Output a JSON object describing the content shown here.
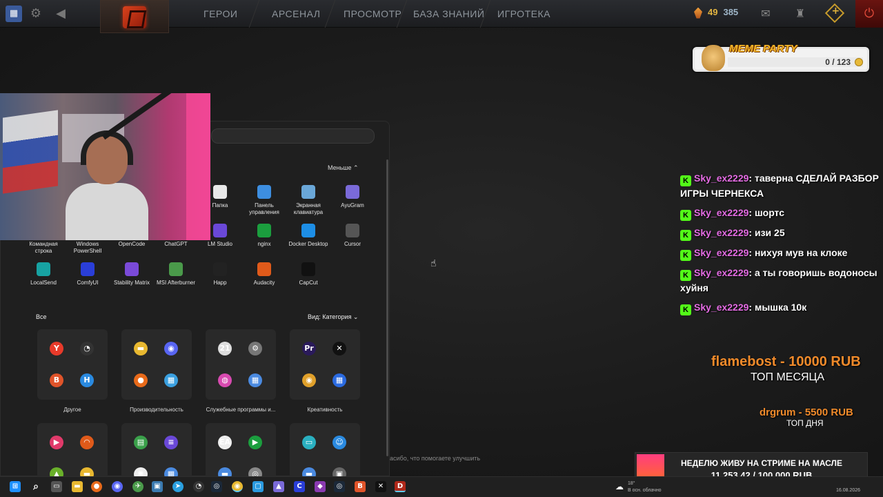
{
  "topbar": {
    "nav": [
      "ГЕРОИ",
      "АРСЕНАЛ",
      "ПРОСМОТР",
      "БАЗА ЗНАНИЙ",
      "ИГРОТЕКА"
    ],
    "currency_a": "49",
    "currency_b": "385"
  },
  "meme_party": {
    "title": "MEME PARTY",
    "count": "0 / 123"
  },
  "start_menu": {
    "less_label": "Меньше ⌃",
    "pinned": [
      {
        "label": "Папка",
        "icon": "folder-icon",
        "color": "#e8e8e8"
      },
      {
        "label": "Панель управления",
        "icon": "control-panel-icon",
        "color": "#3d8ee0"
      },
      {
        "label": "Экранная клавиатура",
        "icon": "keyboard-icon",
        "color": "#6aa7d8"
      },
      {
        "label": "AyuGram",
        "icon": "ayugram-icon",
        "color": "#7a6ad8"
      },
      {
        "label": "Командная строка",
        "icon": "cmd-icon",
        "color": "#3a3a3a"
      },
      {
        "label": "Windows PowerShell",
        "icon": "powershell-icon",
        "color": "#2b5797"
      },
      {
        "label": "OpenCode",
        "icon": "opencode-icon",
        "color": "#444"
      },
      {
        "label": "ChatGPT",
        "icon": "chatgpt-icon",
        "color": "#444"
      },
      {
        "label": "LM Studio",
        "icon": "lm-studio-icon",
        "color": "#6a48d8"
      },
      {
        "label": "nginx",
        "icon": "nginx-icon",
        "color": "#1b9e3e"
      },
      {
        "label": "Docker Desktop",
        "icon": "docker-icon",
        "color": "#1d8ee6"
      },
      {
        "label": "Cursor",
        "icon": "cursor-app-icon",
        "color": "#555"
      },
      {
        "label": "LocalSend",
        "icon": "localsend-icon",
        "color": "#17a2a2"
      },
      {
        "label": "ComfyUI",
        "icon": "comfyui-icon",
        "color": "#2a3ed8"
      },
      {
        "label": "Stability Matrix",
        "icon": "stability-matrix-icon",
        "color": "#7a4ad8"
      },
      {
        "label": "MSI Afterburner",
        "icon": "afterburner-icon",
        "color": "#4a9a4a"
      },
      {
        "label": "Happ",
        "icon": "happ-icon",
        "color": "#222"
      },
      {
        "label": "Audacity",
        "icon": "audacity-icon",
        "color": "#e05a1a"
      },
      {
        "label": "CapCut",
        "icon": "capcut-icon",
        "color": "#111"
      }
    ],
    "all_label": "Все",
    "view_label": "Вид: Категория",
    "groups": [
      {
        "label": "Другое",
        "icons": [
          [
            "Y",
            "#e83a2a"
          ],
          [
            "◔",
            "#333"
          ],
          [
            "B",
            "#e0542a"
          ],
          [
            "H",
            "#2a8ae0"
          ]
        ]
      },
      {
        "label": "Производительность",
        "icons": [
          [
            "▬",
            "#e8b830"
          ],
          [
            "◉",
            "#5865f2"
          ],
          [
            "●",
            "#e86a1a"
          ],
          [
            "▦",
            "#3aa0e0"
          ]
        ]
      },
      {
        "label": "Служебные программы и...",
        "icons": [
          [
            "21",
            "#ddd"
          ],
          [
            "⚙",
            "#777"
          ],
          [
            "◍",
            "#d84ab0"
          ],
          [
            "▦",
            "#4a8ae0"
          ]
        ]
      },
      {
        "label": "Креативность",
        "icons": [
          [
            "Pr",
            "#2a1a5a"
          ],
          [
            "✕",
            "#111"
          ],
          [
            "◉",
            "#e0a02a"
          ],
          [
            "▦",
            "#2a6ae0"
          ]
        ]
      },
      {
        "label": "",
        "icons": [
          [
            "▶",
            "#e03a6a"
          ],
          [
            "◠",
            "#e05a1a"
          ],
          [
            "▲",
            "#6ab02a"
          ],
          [
            "▬",
            "#e8b830"
          ]
        ]
      },
      {
        "label": "",
        "icons": [
          [
            "▤",
            "#3aa04a"
          ],
          [
            "≡",
            "#6a48d8"
          ],
          [
            "✺",
            "#eee"
          ],
          [
            "▦",
            "#4a8ae0"
          ]
        ]
      },
      {
        "label": "",
        "icons": [
          [
            "EA",
            "#eee"
          ],
          [
            "▶",
            "#1b9e3e"
          ],
          [
            "▬",
            "#4a8ae0"
          ],
          [
            "◎",
            "#888"
          ]
        ]
      },
      {
        "label": "",
        "icons": [
          [
            "▭",
            "#2ab0c0"
          ],
          [
            "☺",
            "#2a8ae0"
          ],
          [
            "▬",
            "#4a8ae0"
          ],
          [
            "▣",
            "#666"
          ]
        ]
      }
    ],
    "footer_text": "асибо, что помогаете улучшить"
  },
  "chat": [
    {
      "user": "Sky_ex2229",
      "msg": ": таверна СДЕЛАЙ РАЗБОР ИГРЫ ЧЕРНЕКСА"
    },
    {
      "user": "Sky_ex2229",
      "msg": ": шортс"
    },
    {
      "user": "Sky_ex2229",
      "msg": ": изи 25"
    },
    {
      "user": "Sky_ex2229",
      "msg": ": нихуя мув на клоке"
    },
    {
      "user": "Sky_ex2229",
      "msg": ": а ты говоришь водоносы хуйня"
    },
    {
      "user": "Sky_ex2229",
      "msg": ": мышка 10к"
    }
  ],
  "donations": {
    "top_month": "flamebost - 10000 RUB",
    "top_month_label": "ТОП МЕСЯЦА",
    "top_day": "drgrum - 5500 RUB",
    "top_day_label": "ТОП ДНЯ"
  },
  "goal": {
    "title": "НЕДЕЛЮ ЖИВУ НА СТРИМЕ НА МАСЛЕ",
    "amount": "11 253.42 / 100 000 RUB",
    "progress": 0.113
  },
  "taskbar": {
    "weather_temp": "18°",
    "weather_desc": "В осн. облачно",
    "date": "16.08.2026"
  }
}
